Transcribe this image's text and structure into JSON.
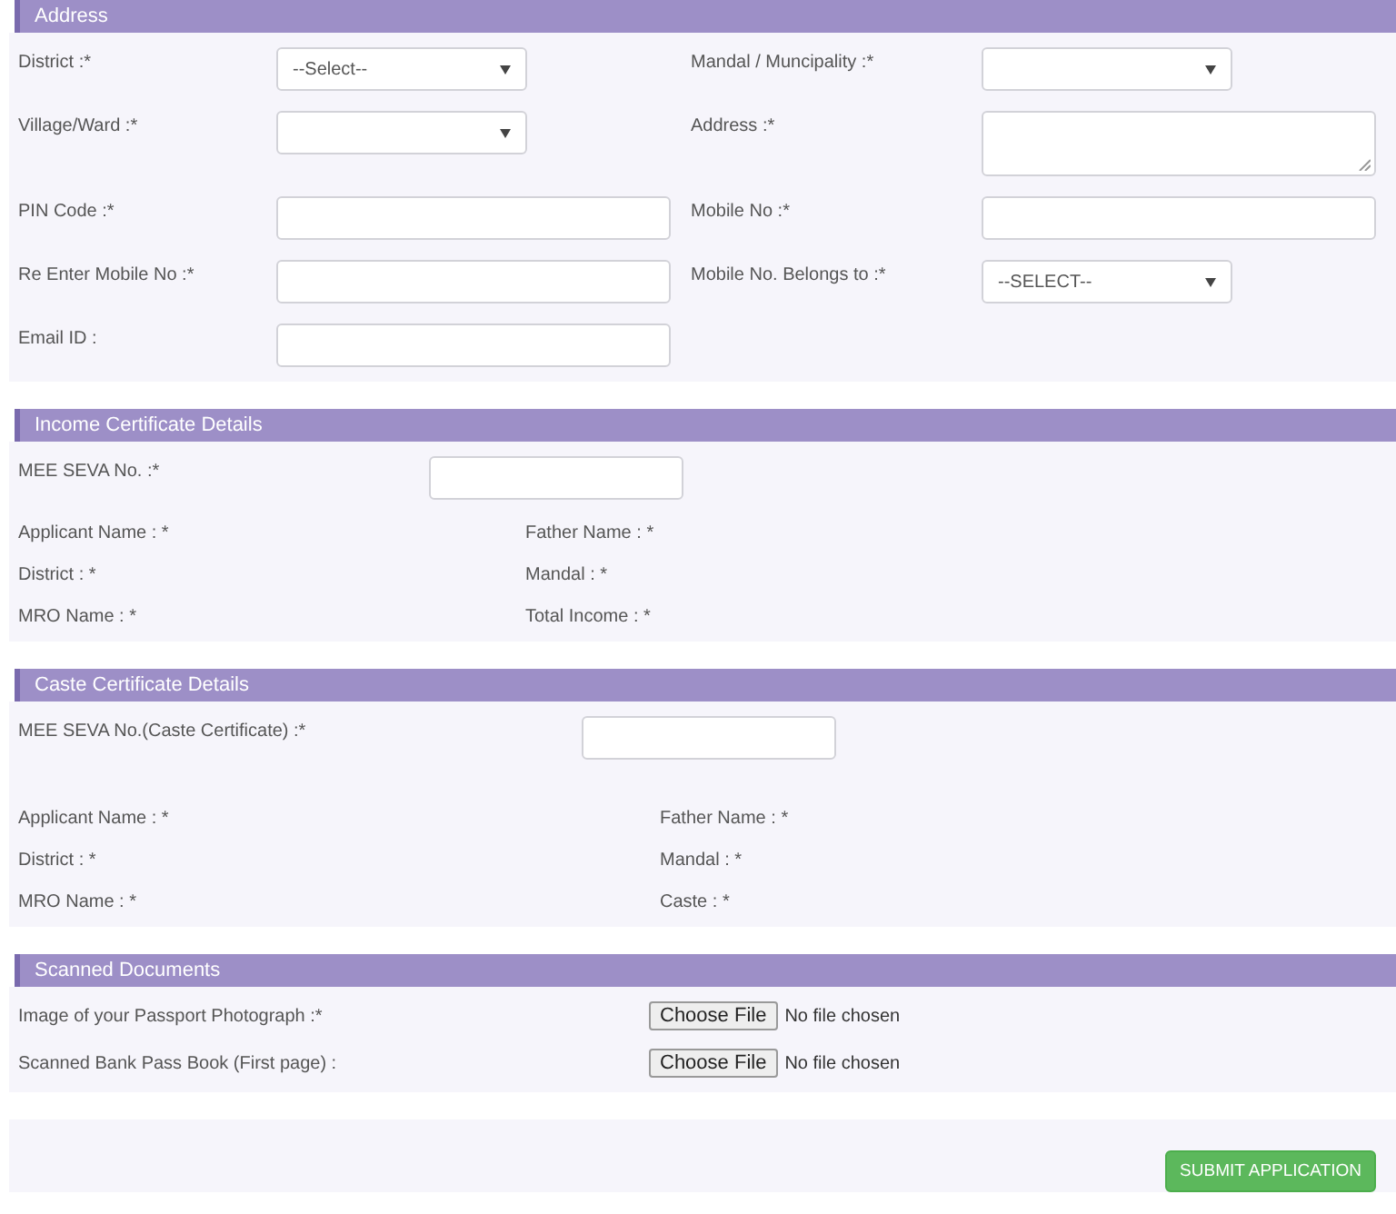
{
  "address": {
    "title": "Address",
    "fields": [
      {
        "label": "District :*",
        "kind": "select",
        "value": "--Select--"
      },
      {
        "label": "Mandal / Muncipality :*",
        "kind": "select"
      },
      {
        "label": "Village/Ward :*",
        "kind": "select"
      },
      {
        "label": "Address :*",
        "kind": "textarea"
      },
      {
        "label": "PIN Code :*",
        "kind": "text"
      },
      {
        "label": "Mobile No :*",
        "kind": "text"
      },
      {
        "label": "Re Enter Mobile No :*",
        "kind": "text"
      },
      {
        "label": "Mobile No. Belongs to :*",
        "kind": "select",
        "value": "--SELECT--"
      },
      {
        "label": "Email ID :",
        "kind": "text"
      }
    ]
  },
  "income": {
    "title": "Income Certificate Details",
    "number_label": "MEE SEVA No. :*",
    "details": [
      "Applicant Name : *",
      "Father Name : *",
      "District : *",
      "Mandal : *",
      "MRO Name : *",
      "Total Income : *"
    ]
  },
  "caste": {
    "title": "Caste Certificate Details",
    "number_label": "MEE SEVA No.(Caste Certificate) :*",
    "details": [
      "Applicant Name : *",
      "Father Name : *",
      "District : *",
      "Mandal : *",
      "MRO Name : *",
      "Caste : *"
    ]
  },
  "scanned": {
    "title": "Scanned Documents",
    "documents": [
      {
        "label": "Image of your Passport Photograph :*",
        "button": "Choose File",
        "status": "No file chosen"
      },
      {
        "label": "Scanned Bank Pass Book (First page) :",
        "button": "Choose File",
        "status": "No file chosen"
      }
    ]
  },
  "submit": "SUBMIT APPLICATION"
}
